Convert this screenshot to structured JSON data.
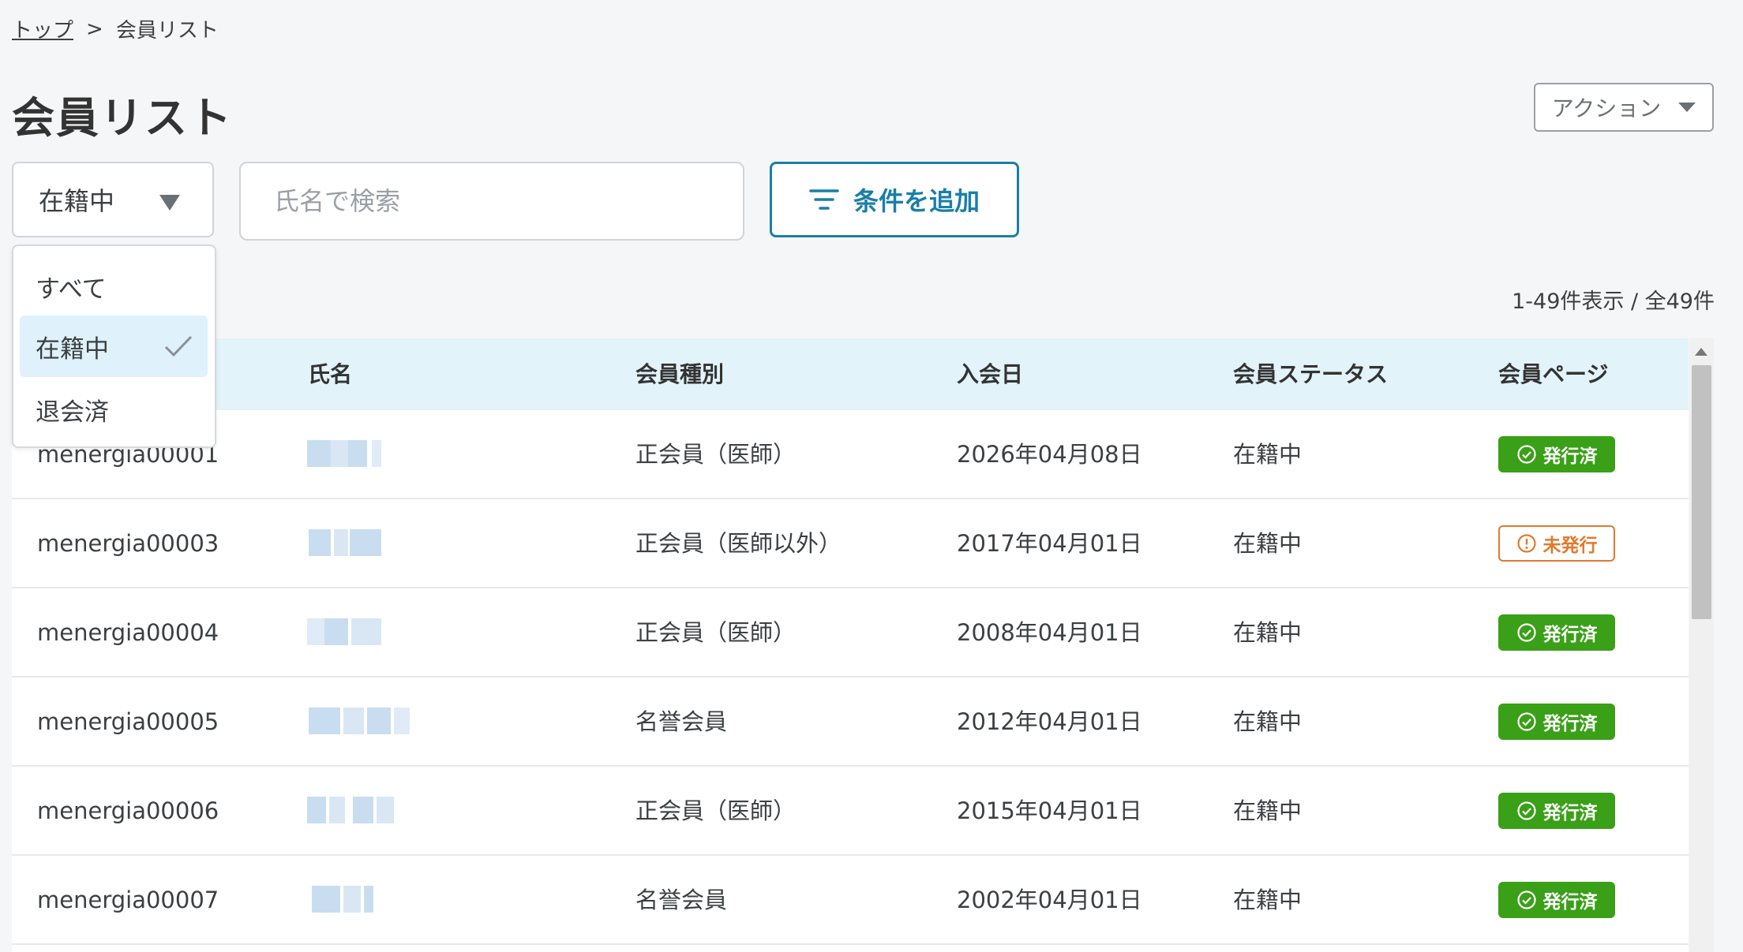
{
  "breadcrumb": {
    "home": "トップ",
    "separator": ">",
    "current": "会員リスト"
  },
  "page": {
    "title": "会員リスト"
  },
  "actions": {
    "label": "アクション"
  },
  "filters": {
    "status_selected": "在籍中",
    "status_options": [
      "すべて",
      "在籍中",
      "退会済"
    ],
    "search_placeholder": "氏名で検索",
    "add_condition_label": "条件を追加"
  },
  "count_text": "1-49件表示 / 全49件",
  "table": {
    "headers": [
      "氏名",
      "会員種別",
      "入会日",
      "会員ステータス",
      "会員ページ"
    ],
    "rows": [
      {
        "id": "menergia00001",
        "type": "正会員（医師）",
        "joined": "2026年04月08日",
        "status": "在籍中",
        "page": "発行済",
        "issued": true
      },
      {
        "id": "menergia00003",
        "type": "正会員（医師以外）",
        "joined": "2017年04月01日",
        "status": "在籍中",
        "page": "未発行",
        "issued": false
      },
      {
        "id": "menergia00004",
        "type": "正会員（医師）",
        "joined": "2008年04月01日",
        "status": "在籍中",
        "page": "発行済",
        "issued": true
      },
      {
        "id": "menergia00005",
        "type": "名誉会員",
        "joined": "2012年04月01日",
        "status": "在籍中",
        "page": "発行済",
        "issued": true
      },
      {
        "id": "menergia00006",
        "type": "正会員（医師）",
        "joined": "2015年04月01日",
        "status": "在籍中",
        "page": "発行済",
        "issued": true
      },
      {
        "id": "menergia00007",
        "type": "名誉会員",
        "joined": "2002年04月01日",
        "status": "在籍中",
        "page": "発行済",
        "issued": true
      }
    ]
  },
  "colors": {
    "accent": "#1a7fa8",
    "issued": "#3aa017",
    "unissued": "#e07a2e",
    "header_bg": "#e2f3fa"
  },
  "icons": {
    "caret": "caret-down-icon",
    "filter": "filter-lines-icon",
    "check": "check-icon",
    "check_circle": "check-circle-icon",
    "alert_circle": "alert-circle-icon"
  }
}
